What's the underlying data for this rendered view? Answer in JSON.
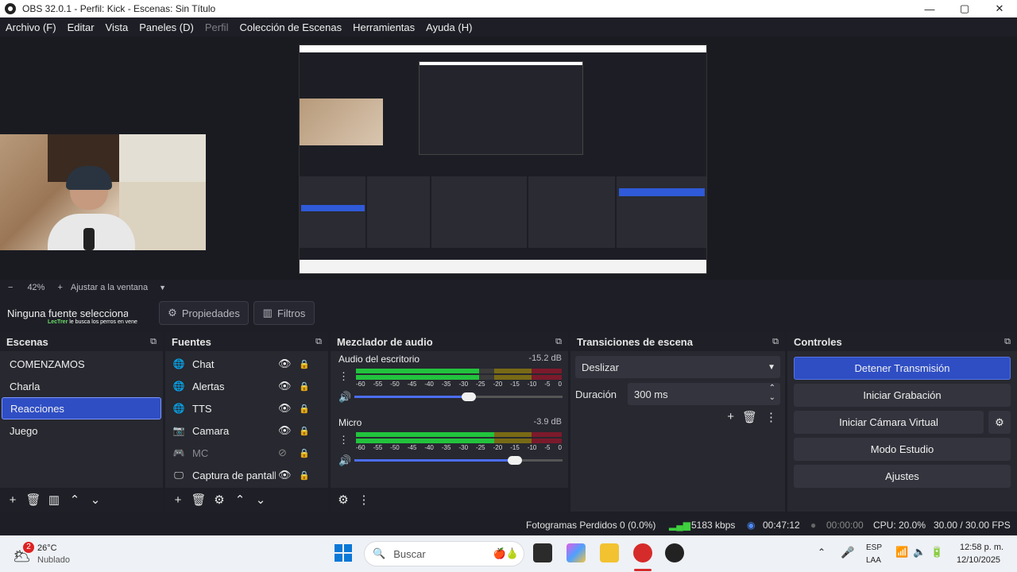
{
  "window": {
    "title": "OBS 32.0.1 - Perfil: Kick - Escenas: Sin Título",
    "min": "—",
    "max": "▢",
    "close": "✕"
  },
  "menu": [
    "Archivo (F)",
    "Editar",
    "Vista",
    "Paneles (D)",
    "Perfil",
    "Colección de Escenas",
    "Herramientas",
    "Ayuda (H)"
  ],
  "zoom": {
    "minus": "−",
    "value": "42%",
    "plus": "+",
    "fit": "Ajustar a la ventana",
    "caret": "▼"
  },
  "source_bar": {
    "selected": "Ninguna fuente seleccionada",
    "ticker_name": "LecTrer",
    "ticker_text": "le busca los perros en vene",
    "properties": "Propiedades",
    "filters": "Filtros"
  },
  "scenes": {
    "title": "Escenas",
    "items": [
      "COMENZAMOS",
      "Charla",
      "Reacciones",
      "Juego"
    ],
    "selected": 2
  },
  "sources": {
    "title": "Fuentes",
    "items": [
      {
        "name": "Chat",
        "icon": "globe-icon",
        "visible": true
      },
      {
        "name": "Alertas",
        "icon": "globe-icon",
        "visible": true
      },
      {
        "name": "TTS",
        "icon": "globe-icon",
        "visible": true
      },
      {
        "name": "Camara",
        "icon": "camera-icon",
        "visible": true
      },
      {
        "name": "MC",
        "icon": "gamepad-icon",
        "visible": false
      },
      {
        "name": "Captura de pantalla",
        "icon": "monitor-icon",
        "visible": true
      }
    ]
  },
  "mixer": {
    "title": "Mezclador de audio",
    "scale": [
      "-60",
      "-55",
      "-50",
      "-45",
      "-40",
      "-35",
      "-30",
      "-25",
      "-20",
      "-15",
      "-10",
      "-5",
      "0"
    ],
    "channels": [
      {
        "name": "Audio del escritorio",
        "db": "-15.2 dB",
        "level": 0.6,
        "volume": 0.55
      },
      {
        "name": "Micro",
        "db": "-3.9 dB",
        "level": 0.88,
        "volume": 0.77
      }
    ]
  },
  "transitions": {
    "title": "Transiciones de escena",
    "type": "Deslizar",
    "duration_label": "Duración",
    "duration": "300 ms"
  },
  "controls": {
    "title": "Controles",
    "stream": "Detener Transmisión",
    "record": "Iniciar Grabación",
    "virtualcam": "Iniciar Cámara Virtual",
    "studio": "Modo Estudio",
    "settings": "Ajustes"
  },
  "status": {
    "dropped": "Fotogramas Perdidos 0 (0.0%)",
    "bitrate": "5183 kbps",
    "stream_time": "00:47:12",
    "rec_time": "00:00:00",
    "cpu": "CPU: 20.0%",
    "fps": "30.00 / 30.00 FPS"
  },
  "taskbar": {
    "temp": "26°C",
    "weather": "Nublado",
    "badge": "2",
    "search": "Buscar",
    "lang1": "ESP",
    "lang2": "LAA",
    "time": "12:58 p. m.",
    "date": "12/10/2025"
  },
  "colors": {
    "accent": "#2f4ec4",
    "meter_green": "#22c33d",
    "meter_yellow": "#786a15",
    "meter_red": "#7b1a2b"
  }
}
